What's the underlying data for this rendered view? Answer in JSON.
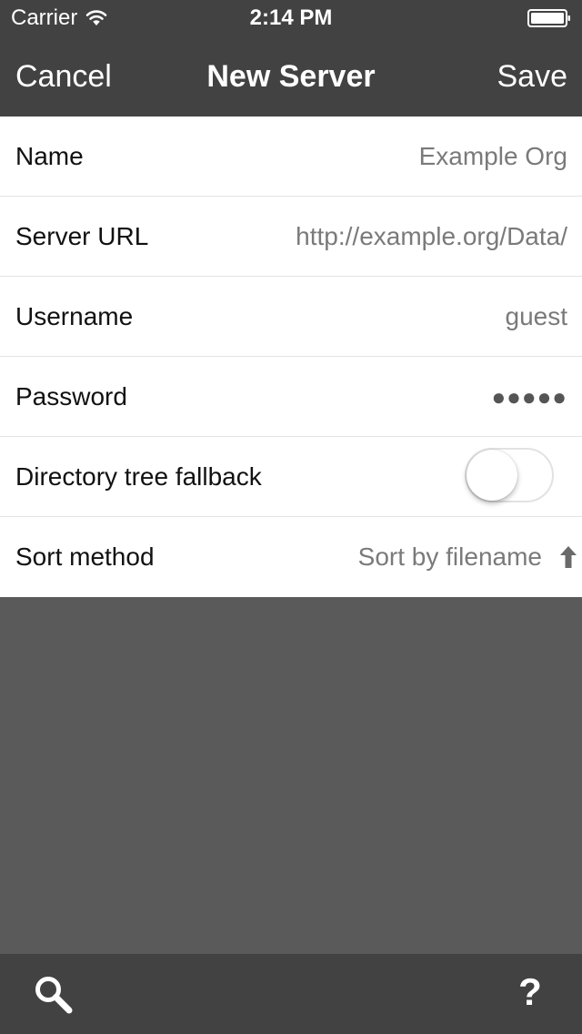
{
  "status_bar": {
    "carrier": "Carrier",
    "time": "2:14 PM"
  },
  "nav_bar": {
    "cancel_label": "Cancel",
    "title": "New Server",
    "save_label": "Save"
  },
  "form": {
    "name": {
      "label": "Name",
      "value": "Example Org"
    },
    "server_url": {
      "label": "Server URL",
      "value": "http://example.org/Data/"
    },
    "username": {
      "label": "Username",
      "value": "guest"
    },
    "password": {
      "label": "Password",
      "value": "●●●●●"
    },
    "directory_tree_fallback": {
      "label": "Directory tree fallback",
      "enabled": false
    },
    "sort_method": {
      "label": "Sort method",
      "value": "Sort by filename",
      "direction_icon": "arrow-up-icon"
    }
  },
  "toolbar": {
    "left_icon": "search-icon",
    "right_icon": "help-icon",
    "help_glyph": "?"
  },
  "colors": {
    "bar_background": "#424242",
    "body_background": "#5a5a5a",
    "form_background": "#ffffff",
    "value_text": "#7a7a7a",
    "label_text": "#111111"
  }
}
